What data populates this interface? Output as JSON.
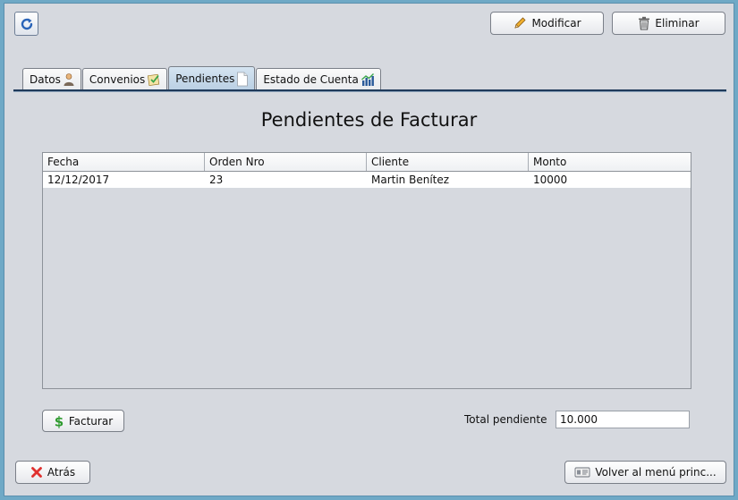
{
  "toolbar": {
    "modify_label": "Modificar",
    "delete_label": "Eliminar"
  },
  "tabs": [
    {
      "label": "Datos",
      "icon": "person-icon",
      "active": false
    },
    {
      "label": "Convenios",
      "icon": "document-check-icon",
      "active": false
    },
    {
      "label": "Pendientes",
      "icon": "blank-page-icon",
      "active": true
    },
    {
      "label": "Estado de Cuenta",
      "icon": "bar-chart-icon",
      "active": false
    }
  ],
  "main": {
    "title": "Pendientes de Facturar",
    "table": {
      "columns": [
        "Fecha",
        "Orden Nro",
        "Cliente",
        "Monto"
      ],
      "rows": [
        [
          "12/12/2017",
          "23",
          "Martin Benítez",
          "10000"
        ]
      ]
    },
    "invoice_label": "Facturar",
    "total_label": "Total pendiente",
    "total_value": "10.000"
  },
  "footer": {
    "back_label": "Atrás",
    "main_menu_label": "Volver al menú princ..."
  },
  "colors": {
    "accent": "#1f3a5a",
    "active_tab": "#c4d8ea",
    "delete_red": "#e0312f",
    "money_green": "#2f9a2f"
  }
}
